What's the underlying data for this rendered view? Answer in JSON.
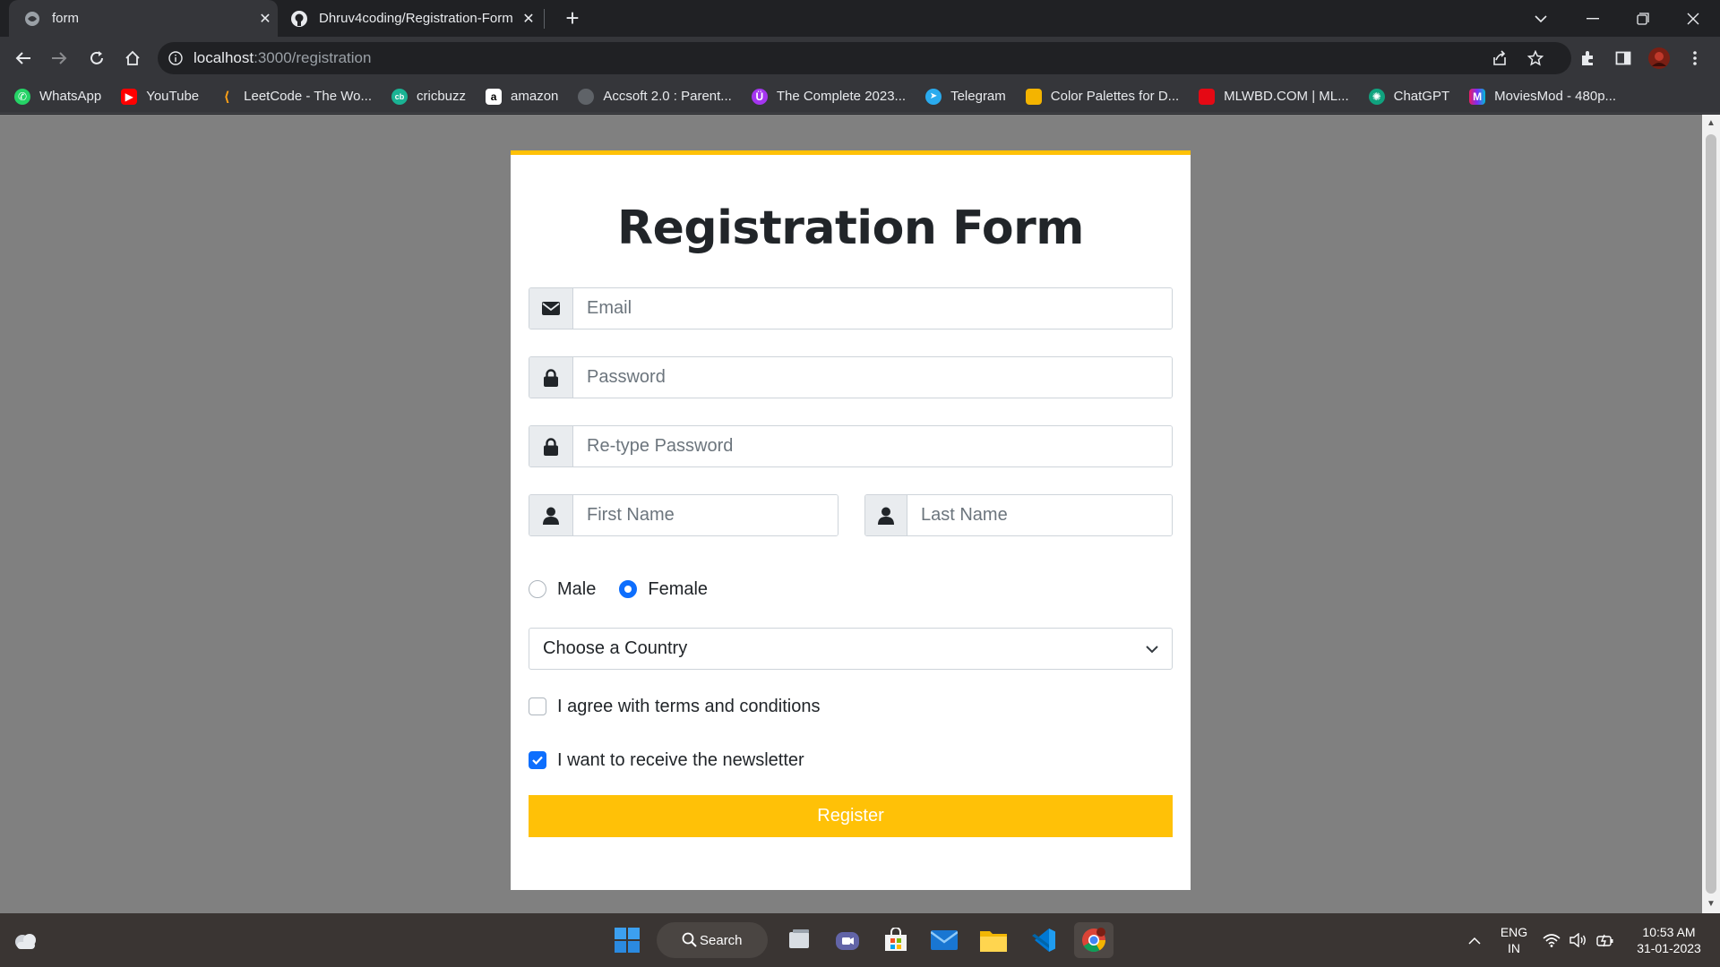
{
  "browser": {
    "tabs": [
      {
        "title": "form",
        "active": true
      },
      {
        "title": "Dhruv4coding/Registration-Form",
        "active": false
      }
    ],
    "url_host": "localhost",
    "url_path": ":3000/registration",
    "bookmarks": [
      {
        "label": "WhatsApp",
        "icon": "whatsapp-icon",
        "color": "#25d366"
      },
      {
        "label": "YouTube",
        "icon": "youtube-icon",
        "color": "#ff0000"
      },
      {
        "label": "LeetCode - The Wo...",
        "icon": "leetcode-icon",
        "color": "#ffa116"
      },
      {
        "label": "cricbuzz",
        "icon": "cricbuzz-icon",
        "color": "#1ab394"
      },
      {
        "label": "amazon",
        "icon": "amazon-icon",
        "color": "#ffffff"
      },
      {
        "label": "Accsoft 2.0 : Parent...",
        "icon": "globe-icon",
        "color": "#9aa0a6"
      },
      {
        "label": "The Complete 2023...",
        "icon": "udemy-icon",
        "color": "#a435f0"
      },
      {
        "label": "Telegram",
        "icon": "telegram-icon",
        "color": "#2aabee"
      },
      {
        "label": "Color Palettes for D...",
        "icon": "palette-icon",
        "color": "#f4b400"
      },
      {
        "label": "MLWBD.COM | ML...",
        "icon": "mlwbd-icon",
        "color": "#e50914"
      },
      {
        "label": "ChatGPT",
        "icon": "chatgpt-icon",
        "color": "#10a37f"
      },
      {
        "label": "MoviesMod - 480p...",
        "icon": "moviesmod-icon",
        "color": "#7b2ff7"
      }
    ]
  },
  "form": {
    "title": "Registration Form",
    "email_placeholder": "Email",
    "password_placeholder": "Password",
    "retype_placeholder": "Re-type Password",
    "first_name_placeholder": "First Name",
    "last_name_placeholder": "Last Name",
    "gender": {
      "male": "Male",
      "female": "Female",
      "selected": "Female"
    },
    "country_select": "Choose a Country",
    "terms_label": "I agree with terms and conditions",
    "terms_checked": false,
    "newsletter_label": "I want to receive the newsletter",
    "newsletter_checked": true,
    "register_label": "Register",
    "accent_color": "#ffc107",
    "check_color": "#0d6efd"
  },
  "taskbar": {
    "search_label": "Search",
    "language": "ENG",
    "region": "IN",
    "time": "10:53 AM",
    "date": "31-01-2023"
  }
}
